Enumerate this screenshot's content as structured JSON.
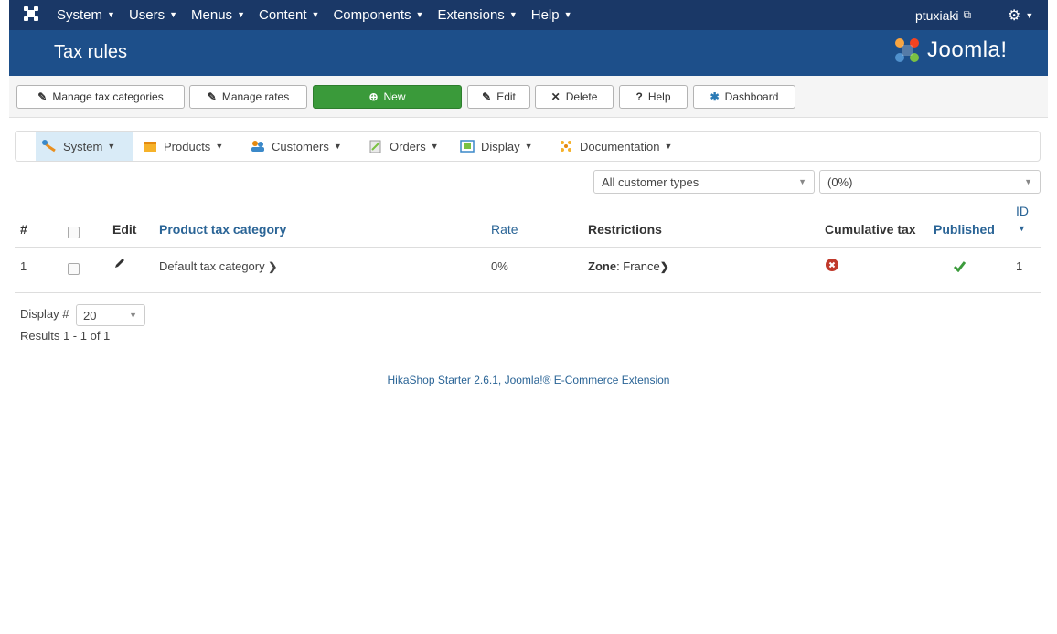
{
  "topbar": {
    "menus": [
      "System",
      "Users",
      "Menus",
      "Content",
      "Components",
      "Extensions",
      "Help"
    ],
    "user": "ptuxiaki"
  },
  "title": "Tax rules",
  "brand": "Joomla!",
  "toolbar": {
    "manage_categories": "Manage tax categories",
    "manage_rates": "Manage rates",
    "new": "New",
    "edit": "Edit",
    "delete": "Delete",
    "help": "Help",
    "dashboard": "Dashboard"
  },
  "submenu": [
    "System",
    "Products",
    "Customers",
    "Orders",
    "Display",
    "Documentation"
  ],
  "filters": {
    "customer_type": "All customer types",
    "rate": "(0%)"
  },
  "table": {
    "headers": {
      "num": "#",
      "edit": "Edit",
      "category": "Product tax category",
      "rate": "Rate",
      "restrictions": "Restrictions",
      "cumulative": "Cumulative tax",
      "published": "Published",
      "id": "ID"
    },
    "rows": [
      {
        "num": "1",
        "category": "Default tax category",
        "rate": "0%",
        "zone_label": "Zone",
        "zone_value": ": France",
        "id": "1"
      }
    ]
  },
  "pagination": {
    "display_label": "Display #",
    "display_value": "20",
    "results": "Results 1 - 1 of 1"
  },
  "footer": "HikaShop Starter 2.6.1, Joomla!® E-Commerce Extension"
}
